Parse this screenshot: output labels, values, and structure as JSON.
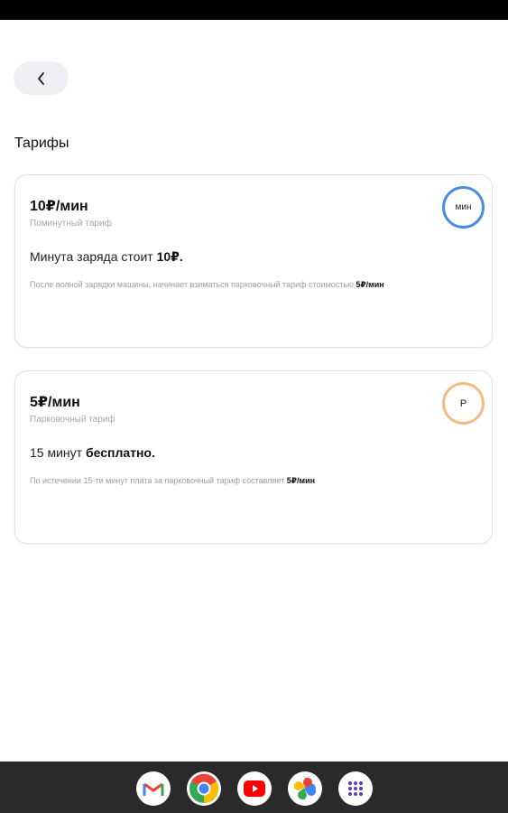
{
  "colors": {
    "accent_blue": "#4a8be6",
    "accent_orange": "#f2bb84",
    "dock_bg": "#2a2a2a"
  },
  "header": {
    "back_icon": "chevron-left-icon"
  },
  "page": {
    "title": "Тарифы"
  },
  "tariffs": [
    {
      "price": "10₽/мин",
      "subtitle": "Поминутный тариф",
      "main_prefix": "Минута заряда стоит ",
      "main_bold": "10₽.",
      "note_prefix": "После полной зарядки машины, начинает взиматься парковочный тариф стоимостью ",
      "note_bold": "5₽/мин",
      "badge": "мин"
    },
    {
      "price": "5₽/мин",
      "subtitle": "Парковочный тариф",
      "main_prefix": "15 минут ",
      "main_bold": "бесплатно.",
      "note_prefix": "По истечении 15-ти минут плата за парковочный тариф составляет ",
      "note_bold": "5₽/мин",
      "badge": "P"
    }
  ],
  "dock": {
    "apps": [
      "gmail-icon",
      "chrome-icon",
      "youtube-icon",
      "photos-icon",
      "app-drawer-icon"
    ]
  }
}
